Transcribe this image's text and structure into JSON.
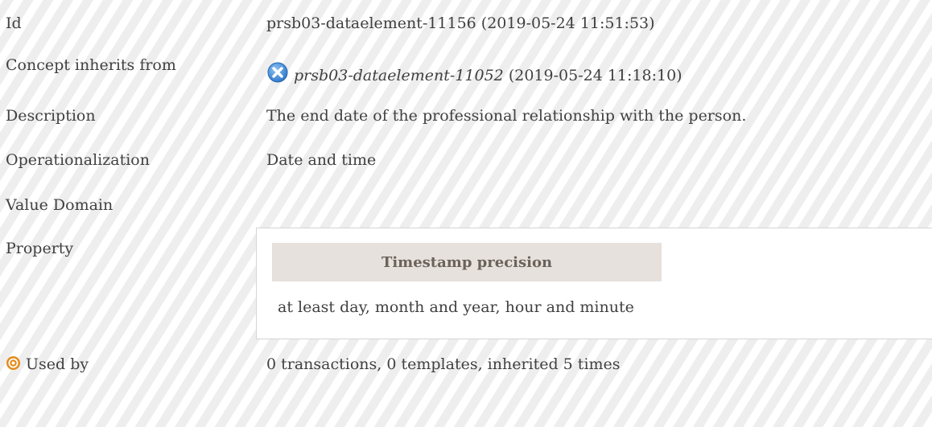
{
  "fields": {
    "id": {
      "label": "Id",
      "value": "prsb03-dataelement-11156 (2019-05-24 11:51:53)"
    },
    "inherits": {
      "label": "Concept inherits from",
      "link": "prsb03-dataelement-11052",
      "date": "(2019-05-24 11:18:10)",
      "icon": "close-circle-icon"
    },
    "description": {
      "label": "Description",
      "value": "The end date of the professional relationship with the person."
    },
    "operationalization": {
      "label": "Operationalization",
      "value": "Date and time"
    },
    "value_domain": {
      "label": "Value Domain"
    },
    "property": {
      "label": "Property",
      "header": "Timestamp precision",
      "value": "at least day, month and year, hour and minute"
    },
    "used_by": {
      "label": "Used by",
      "value": "0 transactions, 0 templates, inherited 5 times",
      "icon": "target-icon"
    }
  },
  "colors": {
    "text": "#404040",
    "stripe": "#eeeeee",
    "header_bg": "#e6e1dc",
    "icon_blue": "#3d8fe0",
    "icon_orange": "#e58a1a"
  }
}
